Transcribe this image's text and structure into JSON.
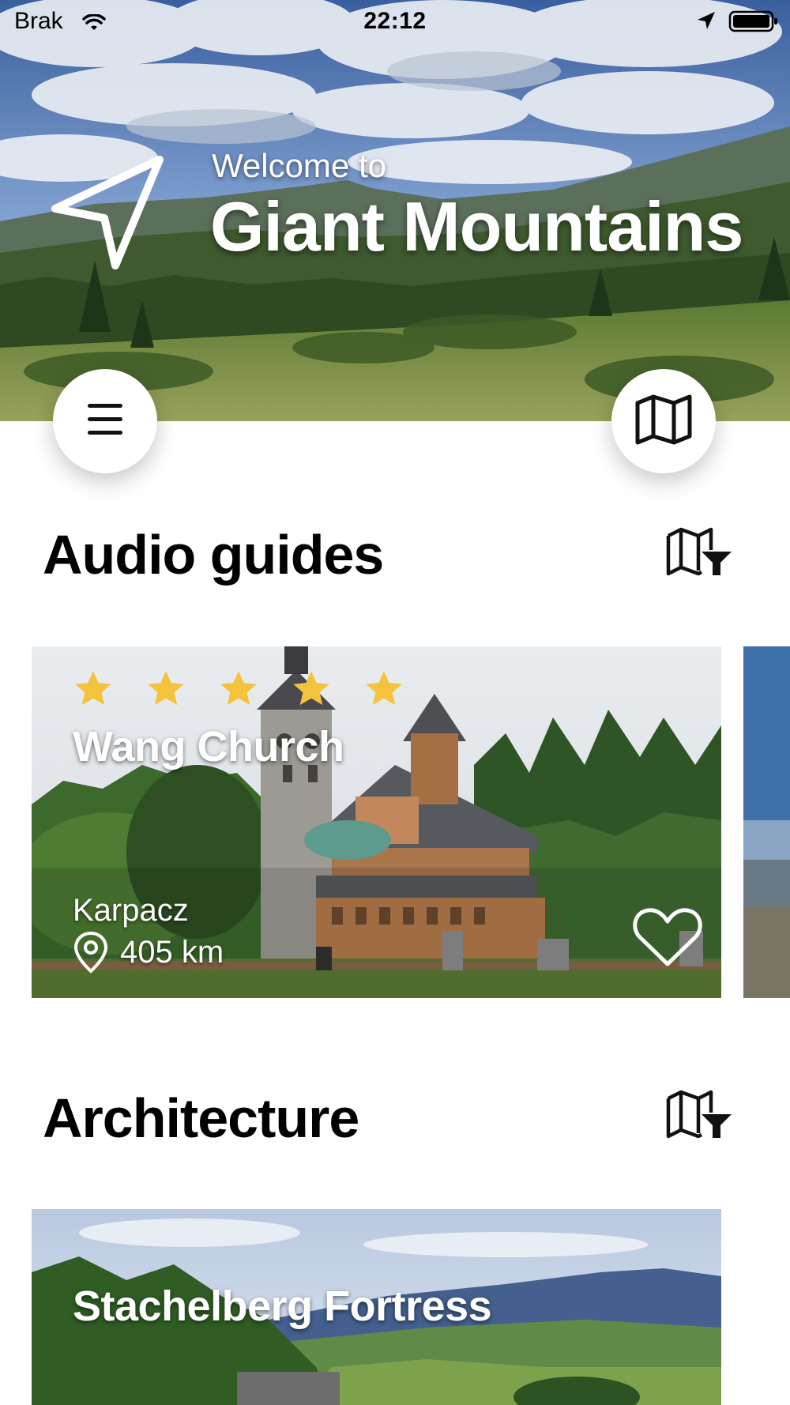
{
  "status_bar": {
    "carrier": "Brak",
    "time": "22:12"
  },
  "hero": {
    "welcome": "Welcome to",
    "title": "Giant Mountains"
  },
  "sections": [
    {
      "title": "Audio guides",
      "cards": [
        {
          "title": "Wang Church",
          "rating": 5,
          "location": "Karpacz",
          "distance": "405 km"
        }
      ]
    },
    {
      "title": "Architecture",
      "cards": [
        {
          "title": "Stachelberg Fortress"
        }
      ]
    }
  ],
  "colors": {
    "star": "#F5C33B",
    "background": "#FFFFFF",
    "text": "#000000"
  },
  "icons": [
    "navigation-arrow-icon",
    "menu-icon",
    "map-icon",
    "map-filter-icon",
    "star-icon",
    "location-pin-icon",
    "heart-icon",
    "wifi-icon",
    "location-services-icon",
    "battery-icon"
  ]
}
